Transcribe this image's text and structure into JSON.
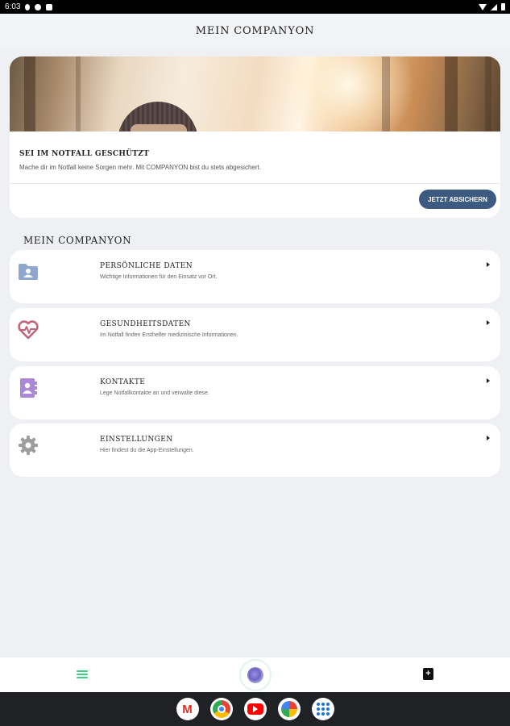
{
  "status_bar": {
    "time": "6:03",
    "icons": [
      "download-icon",
      "vpn-icon",
      "storage-icon",
      "wifi-icon",
      "signal-icon",
      "battery-icon"
    ]
  },
  "app_bar": {
    "title": "MEIN COMPANYON"
  },
  "hero": {
    "title": "SEI IM NOTFALL GESCHÜTZT",
    "subtitle": "Mache dir im Notfall keine Sorgen mehr. Mit COMPANYON bist du stets abgesichert.",
    "button_label": "JETZT ABSICHERN",
    "button_color": "#3d5a80"
  },
  "section": {
    "title": "MEIN COMPANYON"
  },
  "menu_items": [
    {
      "title": "PERSÖNLICHE DATEN",
      "description": "Wichtige Informationen für den Einsatz vor Ort.",
      "icon": "person-folder-icon",
      "icon_color": "#8fa7cf"
    },
    {
      "title": "GESUNDHEITSDATEN",
      "description": "Im Notfall finden Ersthelfer medizinische Informationen.",
      "icon": "heartbeat-icon",
      "icon_color": "#c2657a"
    },
    {
      "title": "KONTAKTE",
      "description": "Lege Notfallkontakte an und verwalte diese.",
      "icon": "contacts-book-icon",
      "icon_color": "#a989d6"
    },
    {
      "title": "EINSTELLUNGEN",
      "description": "Hier findest du die App-Einstellungen.",
      "icon": "gear-icon",
      "icon_color": "#9e9e9e"
    }
  ],
  "bottom_nav": {
    "left_icon": "menu-icon",
    "center_icon": "companion-orb-icon",
    "right_icon": "contact-book-icon",
    "accent_color": "#3ecf86"
  },
  "taskbar": {
    "apps": [
      "gmail-icon",
      "chrome-icon",
      "youtube-icon",
      "photos-icon",
      "app-drawer-icon"
    ]
  }
}
